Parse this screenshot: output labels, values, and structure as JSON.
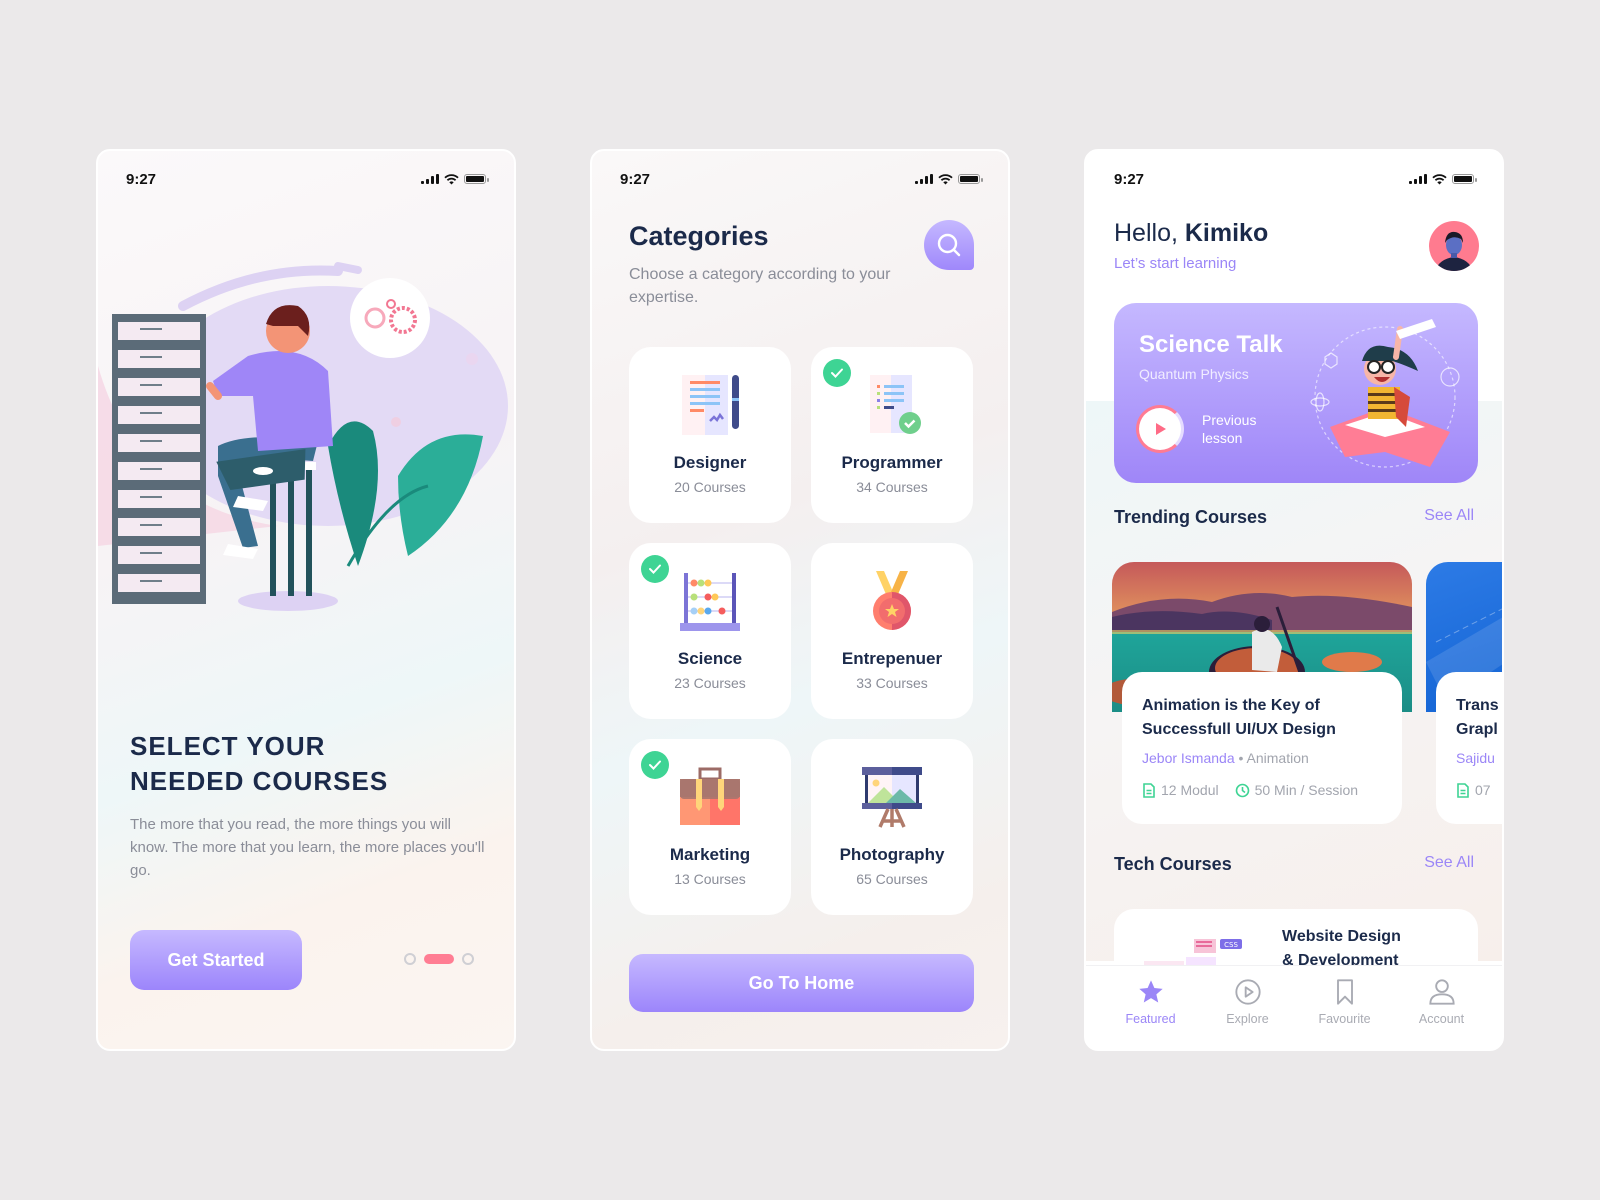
{
  "colors": {
    "accent": "#9b86f7",
    "navy": "#1b2a4a",
    "muted": "#8a8d98",
    "pink": "#ff7d93",
    "check_green": "#3ed494"
  },
  "status_bar": {
    "time": "9:27"
  },
  "screen1": {
    "title": "SELECT YOUR\nNEEDED COURSES",
    "description": "The more that you read, the more things you will know. The more that you learn, the more places you'll go.",
    "cta_label": "Get Started",
    "pagination": {
      "total": 3,
      "active_index": 1
    },
    "illustration": "developer-with-laptop-and-server-rack"
  },
  "screen2": {
    "title": "Categories",
    "subtitle": "Choose a category according to your expertise.",
    "search_icon": "search-icon",
    "categories": [
      {
        "name": "Designer",
        "count": "20 Courses",
        "selected": false,
        "icon": "designer-icon"
      },
      {
        "name": "Programmer",
        "count": "34 Courses",
        "selected": true,
        "icon": "programmer-icon"
      },
      {
        "name": "Science",
        "count": "23 Courses",
        "selected": true,
        "icon": "abacus-icon"
      },
      {
        "name": "Entrepenuer",
        "count": "33 Courses",
        "selected": false,
        "icon": "medal-icon"
      },
      {
        "name": "Marketing",
        "count": "13 Courses",
        "selected": true,
        "icon": "briefcase-icon"
      },
      {
        "name": "Photography",
        "count": "65 Courses",
        "selected": false,
        "icon": "easel-picture-icon"
      }
    ],
    "cta_label": "Go To Home"
  },
  "screen3": {
    "greeting_prefix": "Hello, ",
    "user_name": "Kimiko",
    "greeting_sub": "Let’s start learning",
    "hero": {
      "title": "Science Talk",
      "subtitle": "Quantum Physics",
      "play_label": "Previous\nlesson"
    },
    "trending": {
      "heading": "Trending Courses",
      "see_all": "See All",
      "courses": [
        {
          "title": "Animation is the Key of\nSuccessfull UI/UX Design",
          "author": "Jebor Ismanda",
          "category": "Animation",
          "modules": "12 Modul",
          "duration": "50 Min / Session"
        },
        {
          "title": "Trans\nGrapl",
          "author": "Sajidu",
          "category": "",
          "modules": "07",
          "duration": ""
        }
      ]
    },
    "tech": {
      "heading": "Tech Courses",
      "see_all": "See All",
      "courses": [
        {
          "title": "Website Design\n& Development",
          "badge": "CSS"
        }
      ]
    },
    "tabs": [
      {
        "label": "Featured",
        "icon": "star-icon",
        "active": true
      },
      {
        "label": "Explore",
        "icon": "play-circle-icon",
        "active": false
      },
      {
        "label": "Favourite",
        "icon": "bookmark-icon",
        "active": false
      },
      {
        "label": "Account",
        "icon": "user-icon",
        "active": false
      }
    ]
  }
}
